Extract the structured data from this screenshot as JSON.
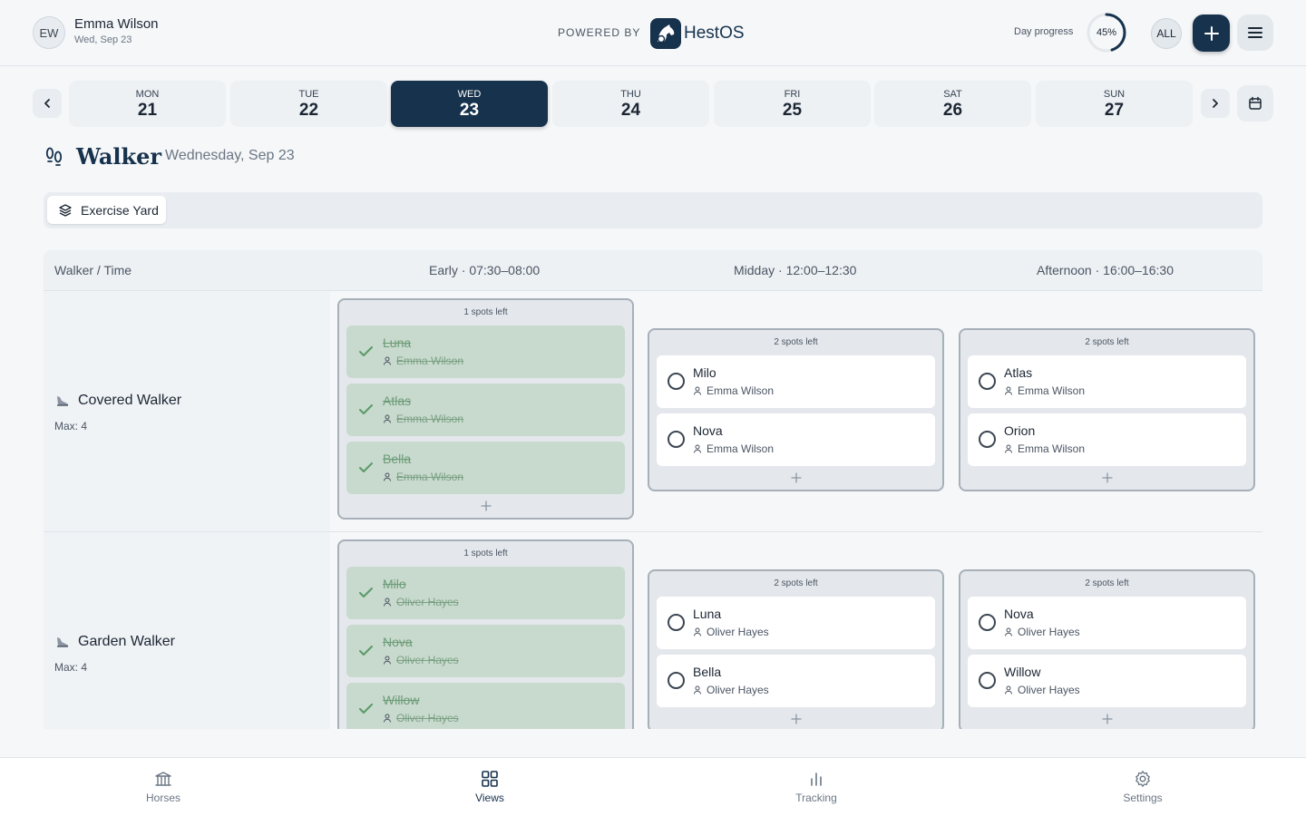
{
  "header": {
    "avatar_initials": "EW",
    "user_name": "Emma Wilson",
    "user_date": "Wed, Sep 23",
    "powered_by": "POWERED BY",
    "brand": "HestOS",
    "day_progress_label": "Day progress",
    "day_progress_value": 45,
    "day_progress_text": "45%",
    "filter_label": "ALL",
    "add_icon": "plus-icon",
    "menu_icon": "menu-icon"
  },
  "days": [
    {
      "dow": "MON",
      "num": "21",
      "active": false
    },
    {
      "dow": "TUE",
      "num": "22",
      "active": false
    },
    {
      "dow": "WED",
      "num": "23",
      "active": true
    },
    {
      "dow": "THU",
      "num": "24",
      "active": false
    },
    {
      "dow": "FRI",
      "num": "25",
      "active": false
    },
    {
      "dow": "SAT",
      "num": "26",
      "active": false
    },
    {
      "dow": "SUN",
      "num": "27",
      "active": false
    }
  ],
  "page": {
    "title": "Walker",
    "subtitle": "Wednesday, Sep 23",
    "location_chip": "Exercise Yard"
  },
  "table": {
    "headers": [
      "Walker / Time",
      "Early · 07:30–08:00",
      "Midday · 12:00–12:30",
      "Afternoon · 16:00–16:30"
    ],
    "rows": [
      {
        "walker": "Covered Walker",
        "max": "Max: 4",
        "slots": [
          {
            "spots": "1 spots left",
            "entries": [
              {
                "horse": "Luna",
                "person": "Emma Wilson",
                "done": true
              },
              {
                "horse": "Atlas",
                "person": "Emma Wilson",
                "done": true
              },
              {
                "horse": "Bella",
                "person": "Emma Wilson",
                "done": true
              }
            ]
          },
          {
            "spots": "2 spots left",
            "entries": [
              {
                "horse": "Milo",
                "person": "Emma Wilson",
                "done": false
              },
              {
                "horse": "Nova",
                "person": "Emma Wilson",
                "done": false
              }
            ]
          },
          {
            "spots": "2 spots left",
            "entries": [
              {
                "horse": "Atlas",
                "person": "Emma Wilson",
                "done": false
              },
              {
                "horse": "Orion",
                "person": "Emma Wilson",
                "done": false
              }
            ]
          }
        ]
      },
      {
        "walker": "Garden Walker",
        "max": "Max: 4",
        "slots": [
          {
            "spots": "1 spots left",
            "entries": [
              {
                "horse": "Milo",
                "person": "Oliver Hayes",
                "done": true
              },
              {
                "horse": "Nova",
                "person": "Oliver Hayes",
                "done": true
              },
              {
                "horse": "Willow",
                "person": "Oliver Hayes",
                "done": true
              }
            ]
          },
          {
            "spots": "2 spots left",
            "entries": [
              {
                "horse": "Luna",
                "person": "Oliver Hayes",
                "done": false
              },
              {
                "horse": "Bella",
                "person": "Oliver Hayes",
                "done": false
              }
            ]
          },
          {
            "spots": "2 spots left",
            "entries": [
              {
                "horse": "Nova",
                "person": "Oliver Hayes",
                "done": false
              },
              {
                "horse": "Willow",
                "person": "Oliver Hayes",
                "done": false
              }
            ]
          }
        ]
      }
    ]
  },
  "bottom_nav": [
    {
      "label": "Horses",
      "icon": "stable-icon",
      "active": false
    },
    {
      "label": "Views",
      "icon": "grid-icon",
      "active": true
    },
    {
      "label": "Tracking",
      "icon": "bar-chart-icon",
      "active": false
    },
    {
      "label": "Settings",
      "icon": "gear-icon",
      "active": false
    }
  ],
  "colors": {
    "brand": "#17324d",
    "done_bg": "#c8d9cd",
    "done_text": "#6c9c77",
    "check": "#5a9a68"
  }
}
